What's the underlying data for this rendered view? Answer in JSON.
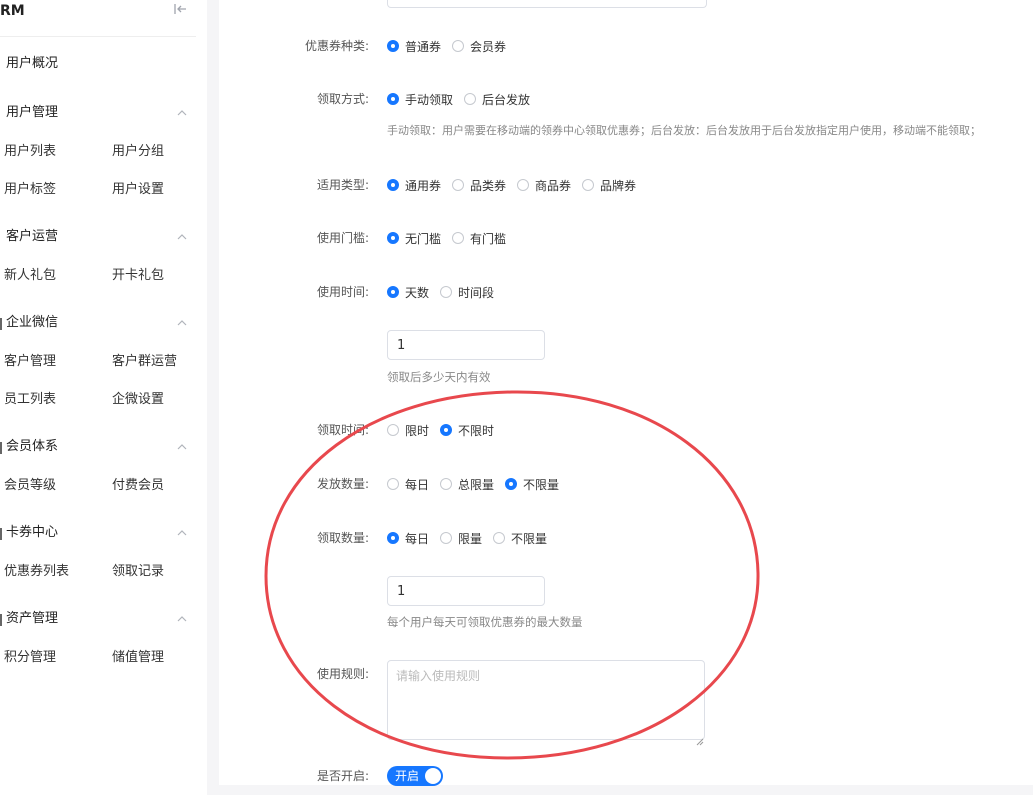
{
  "sidebar": {
    "brand": "RM",
    "groups": [
      {
        "title": "用户概况",
        "items": []
      },
      {
        "title": "用户管理",
        "items": [
          "用户列表",
          "用户分组",
          "用户标签",
          "用户设置"
        ]
      },
      {
        "title": "客户运营",
        "items": [
          "新人礼包",
          "开卡礼包"
        ]
      },
      {
        "title": "企业微信",
        "items": [
          "客户管理",
          "客户群运营",
          "员工列表",
          "企微设置"
        ]
      },
      {
        "title": "会员体系",
        "items": [
          "会员等级",
          "付费会员"
        ]
      },
      {
        "title": "卡券中心",
        "items": [
          "优惠券列表",
          "领取记录"
        ]
      },
      {
        "title": "资产管理",
        "items": [
          "积分管理",
          "储值管理"
        ]
      }
    ]
  },
  "form": {
    "coupon_kind": {
      "label": "优惠券种类:",
      "options": [
        "普通券",
        "会员券"
      ],
      "selected": 0
    },
    "receive_method": {
      "label": "领取方式:",
      "options": [
        "手动领取",
        "后台发放"
      ],
      "selected": 0,
      "help": "手动领取：用户需要在移动端的领券中心领取优惠券；后台发放：后台发放用于后台发放指定用户使用，移动端不能领取；"
    },
    "apply_type": {
      "label": "适用类型:",
      "options": [
        "通用券",
        "品类券",
        "商品券",
        "品牌券"
      ],
      "selected": 0
    },
    "threshold": {
      "label": "使用门槛:",
      "options": [
        "无门槛",
        "有门槛"
      ],
      "selected": 0
    },
    "use_time": {
      "label": "使用时间:",
      "options": [
        "天数",
        "时间段"
      ],
      "selected": 0,
      "days_value": "1",
      "help": "领取后多少天内有效"
    },
    "receive_time": {
      "label": "领取时间:",
      "options": [
        "限时",
        "不限时"
      ],
      "selected": 1
    },
    "issue_qty": {
      "label": "发放数量:",
      "options": [
        "每日",
        "总限量",
        "不限量"
      ],
      "selected": 2
    },
    "receive_qty": {
      "label": "领取数量:",
      "options": [
        "每日",
        "限量",
        "不限量"
      ],
      "selected": 0,
      "value": "1",
      "help": "每个用户每天可领取优惠券的最大数量"
    },
    "rules": {
      "label": "使用规则:",
      "placeholder": "请输入使用规则",
      "value": ""
    },
    "enabled": {
      "label": "是否开启:",
      "switch_text": "开启",
      "on": true
    }
  },
  "icons": {
    "collapse": "collapse-left-icon",
    "chevron": "chevron-up-icon",
    "resize": "resize-grip-icon"
  },
  "colors": {
    "primary": "#1677ff",
    "annotation": "#e8484d"
  }
}
